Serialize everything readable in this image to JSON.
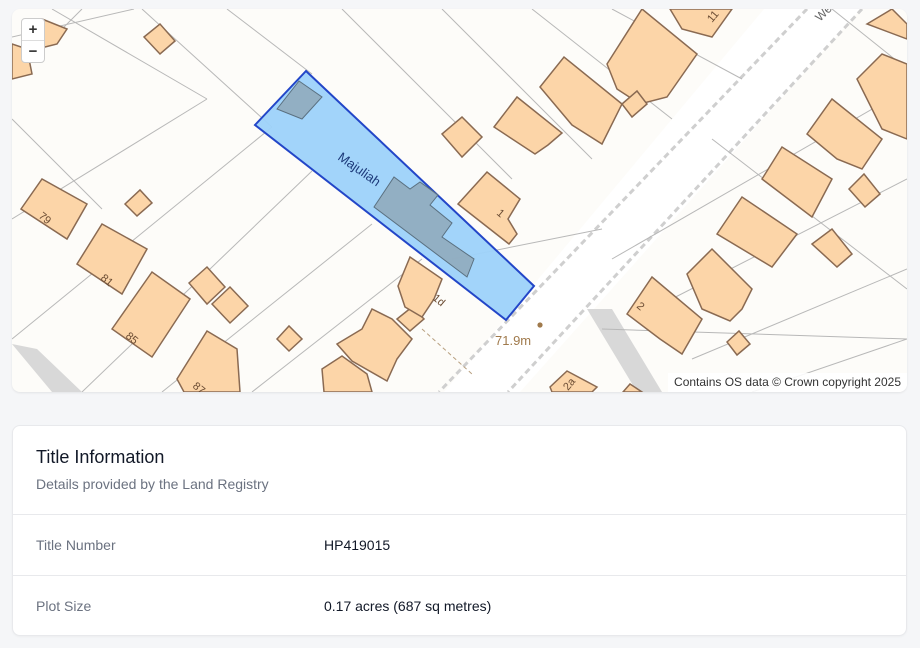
{
  "map": {
    "zoom_in_label": "+",
    "zoom_out_label": "−",
    "attribution": "Contains OS data © Crown copyright 2025",
    "plot_label": "Majuliah",
    "elevation_label": "71.9m",
    "street_label": "We",
    "house_numbers": [
      "79",
      "81",
      "85",
      "87",
      "1",
      "1d",
      "2",
      "11",
      "2a"
    ],
    "colors": {
      "background": "#fdfcf9",
      "building_fill": "#fcd5a8",
      "building_stroke": "#8a6a52",
      "plot_fill": "#9dd2fa",
      "plot_stroke": "#2346c8",
      "label_color": "#a07a4c"
    }
  },
  "title_info": {
    "title": "Title Information",
    "subtitle": "Details provided by the Land Registry",
    "rows": [
      {
        "label": "Title Number",
        "value": "HP419015"
      },
      {
        "label": "Plot Size",
        "value": "0.17 acres (687 sq metres)"
      }
    ]
  }
}
